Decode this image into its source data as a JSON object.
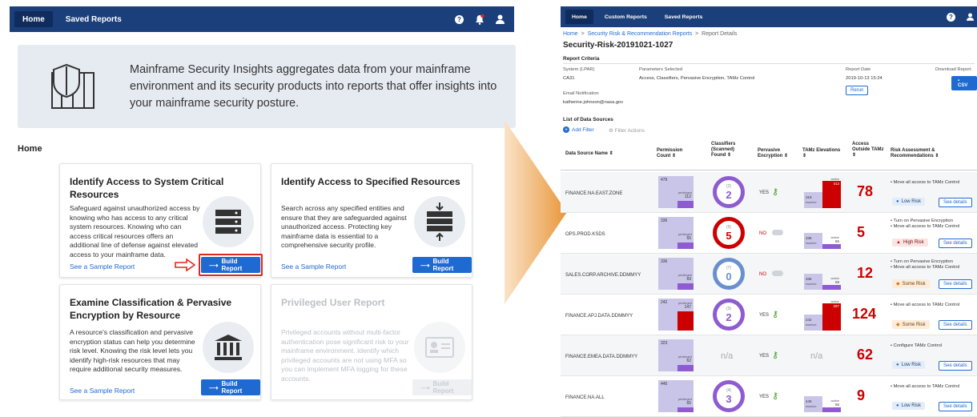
{
  "left": {
    "nav": {
      "home": "Home",
      "saved": "Saved Reports"
    },
    "banner": "Mainframe Security Insights aggregates data from your mainframe environment and its security products into reports that offer insights into your mainframe security posture.",
    "home_heading": "Home",
    "cards": [
      {
        "title": "Identify Access to System Critical Resources",
        "desc": "Safeguard against unauthorized access by knowing who has access to any critical system resources. Knowing who can access critical resources offers an additional line of defense against elevated access to your mainframe data.",
        "sample": "See a Sample Report",
        "button": "Build Report"
      },
      {
        "title": "Identify Access to Specified Resources",
        "desc": "Search across any specified entities and ensure that they are safeguarded against unauthorized access. Protecting key mainframe data is essential to a comprehensive security profile.",
        "sample": "See a Sample Report",
        "button": "Build Report"
      },
      {
        "title": "Examine Classification & Pervasive Encryption by Resource",
        "desc": "A resource's classification and pervasive encryption status can help you determine risk level. Knowing the risk level lets you identify high-risk resources that may require additional security measures.",
        "sample": "See a Sample Report",
        "button": "Build Report"
      },
      {
        "title": "Privileged User Report",
        "desc": "Privileged accounts without multi-factor authentication pose significant risk to your mainframe environment. Identify which privileged accounts are not using MFA so you can implement MFA logging for these accounts.",
        "sample": "",
        "button": "Build Report"
      }
    ]
  },
  "right": {
    "nav": {
      "home": "Home",
      "custom": "Custom Reports",
      "saved": "Saved Reports"
    },
    "crumb": {
      "home": "Home",
      "sec": "Security Risk & Recommendation Reports",
      "details": "Report Details",
      "sep": ">"
    },
    "title": "Security-Risk-20191021-1027",
    "criteria": {
      "heading": "Report Criteria",
      "system_lbl": "System (LPAR)",
      "system_val": "CA31",
      "params_lbl": "Parameters Selected",
      "params_val": "Access, Classifiers, Pervasive Encryption,  TAMz Control",
      "date_lbl": "Report Date",
      "date_val": "2019-10-13 15:24",
      "download_lbl": "Download Report",
      "csv": "CSV",
      "rerun": "Rerun",
      "email_lbl": "Email Notification",
      "email_val": "katherine.johnson@nasa.gov"
    },
    "list_heading": "List of Data Sources",
    "add_filter": "Add Filter",
    "filter_actions": "Filter Actions",
    "headers": [
      "Data Source Name",
      "Permission Count",
      "Classifiers (Scanned) Found",
      "Pervasive Encryption",
      "TAMz Elevations",
      "Access Outside TAMz",
      "Risk Assessment & Recommendations"
    ],
    "sublabels": {
      "privileged": "privileged",
      "inactive": "inactive",
      "active": "active",
      "see": "See details",
      "na": "n/a"
    },
    "rows": [
      {
        "name": "FINANCE.NA.EAST.ZONE",
        "perm_total": "479",
        "perm_priv": "112",
        "cls_scanned": "(2)",
        "cls_found": "2",
        "enc": "YES",
        "tamz_inactive": "319",
        "tamz_active": "412",
        "outside": "78",
        "recs": [
          "• Move all access to TAMz Control"
        ],
        "risk": "Low Risk",
        "risk_level": "low"
      },
      {
        "name": "OPS.PROD.KSDS",
        "perm_total": "336",
        "perm_priv": "65",
        "cls_scanned": "(5)",
        "cls_found": "5",
        "enc": "NO",
        "tamz_inactive": "336",
        "tamz_active": "65",
        "outside": "5",
        "recs": [
          "• Turn on Pervasive Encryption",
          "• Move all access to TAMz Control"
        ],
        "risk": "High Risk",
        "risk_level": "high"
      },
      {
        "name": "SALES.CORP.ARCHIVE.DDMMYY",
        "perm_total": "336",
        "perm_priv": "69",
        "cls_scanned": "(7)",
        "cls_found": "0",
        "enc": "NO",
        "tamz_inactive": "336",
        "tamz_active": "69",
        "outside": "12",
        "recs": [
          "• Turn on Pervasive Encryption",
          "• Move all access to TAMz Control"
        ],
        "risk": "Some Risk",
        "risk_level": "some"
      },
      {
        "name": "FINANCE.APJ.DATA.DDMMYY",
        "perm_total": "242",
        "perm_priv": "147",
        "cls_scanned": "(3)",
        "cls_found": "2",
        "enc": "YES",
        "tamz_inactive": "242",
        "tamz_active": "297",
        "outside": "124",
        "recs": [
          "• Move all access to TAMz Control"
        ],
        "risk": "Some Risk",
        "risk_level": "some"
      },
      {
        "name": "FINANCE.EMEA.DATA.DDMMYY",
        "perm_total": "323",
        "perm_priv": "62",
        "cls_scanned": "",
        "cls_found": "n/a",
        "enc": "YES",
        "tamz_inactive": "",
        "tamz_active": "",
        "outside": "62",
        "recs": [
          "• Configure TAMz Control"
        ],
        "risk": "Low Risk",
        "risk_level": "low"
      },
      {
        "name": "FINANCE.NA.ALL",
        "perm_total": "445",
        "perm_priv": "65",
        "cls_scanned": "(4)",
        "cls_found": "3",
        "enc": "YES",
        "tamz_inactive": "445",
        "tamz_active": "65",
        "outside": "9",
        "recs": [
          "• Move all access to TAMz Control"
        ],
        "risk": "Low Risk",
        "risk_level": "low"
      }
    ]
  }
}
